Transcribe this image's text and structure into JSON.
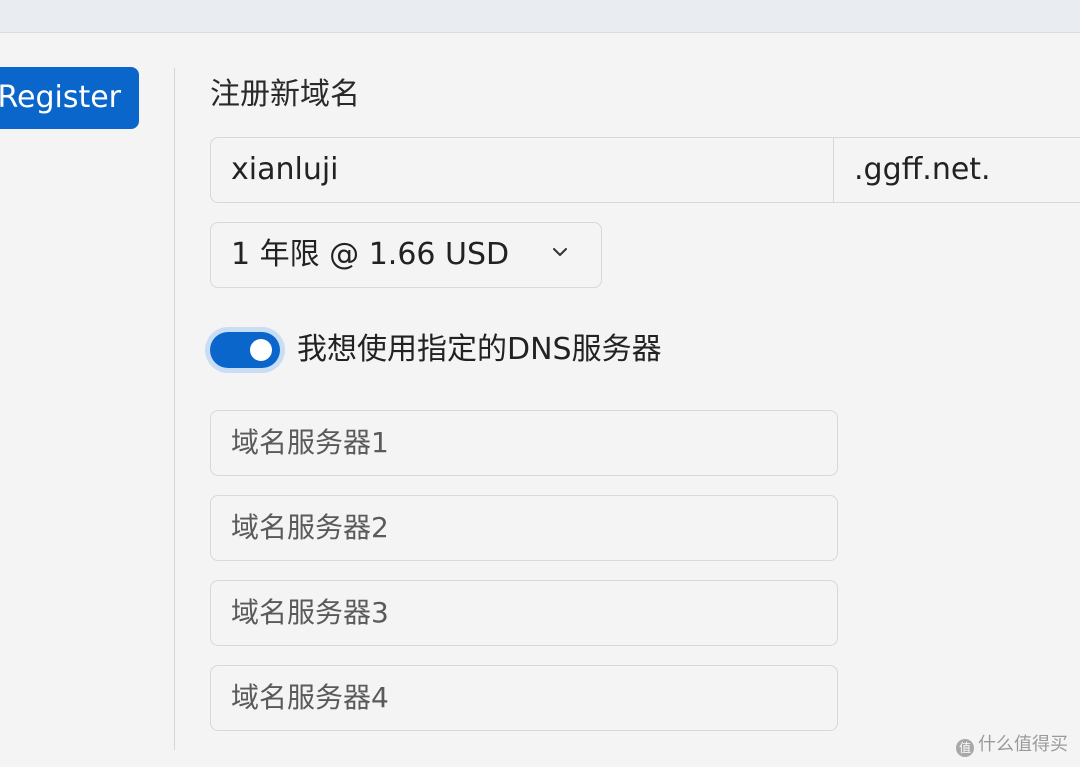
{
  "sidebar": {
    "register_label": "Register"
  },
  "form": {
    "title": "注册新域名",
    "domain_value": "xianluji",
    "domain_suffix": ".ggff.net.",
    "term_selected": "1 年限 @ 1.66 USD",
    "custom_dns_toggle": {
      "label": "我想使用指定的DNS服务器",
      "checked": true
    },
    "nameservers": [
      {
        "placeholder": "域名服务器1",
        "value": ""
      },
      {
        "placeholder": "域名服务器2",
        "value": ""
      },
      {
        "placeholder": "域名服务器3",
        "value": ""
      },
      {
        "placeholder": "域名服务器4",
        "value": ""
      }
    ]
  },
  "watermark": {
    "logo": "值",
    "text": "什么值得买"
  },
  "colors": {
    "accent": "#0b66cc",
    "background": "#f4f4f4"
  }
}
